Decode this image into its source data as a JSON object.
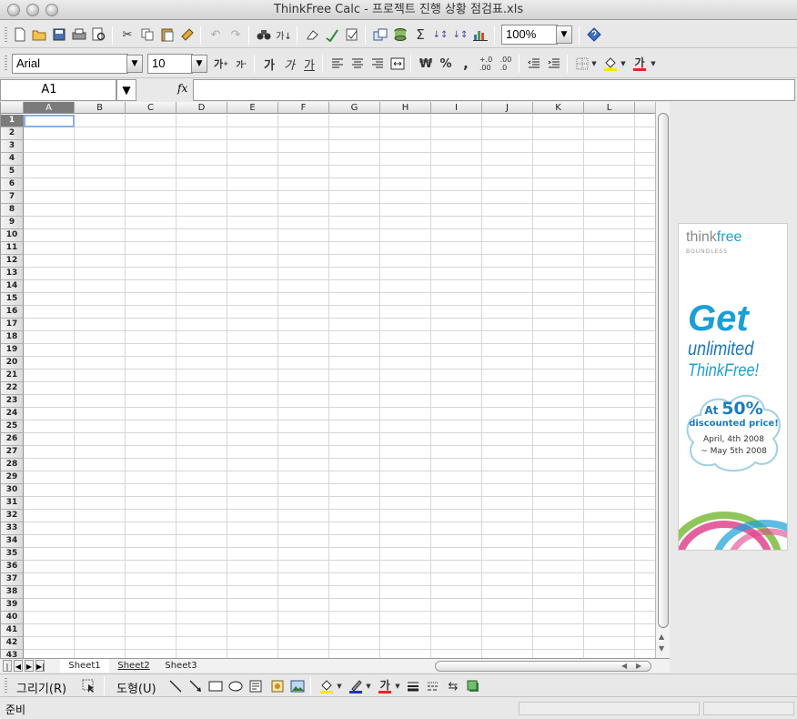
{
  "window": {
    "title": "ThinkFree Calc - 프로젝트 진행 상황 점검표.xls"
  },
  "toolbar": {
    "zoom": "100%",
    "font_name": "Arial",
    "font_size": "10"
  },
  "format_toolbar": {
    "grow_font": "가",
    "shrink_font": "가",
    "bold": "가",
    "italic": "가",
    "underline": "가",
    "currency": "₩",
    "percent": "%",
    "comma": ",",
    "font_color": "가"
  },
  "formula_bar": {
    "cell_ref": "A1",
    "fx": "fx",
    "formula": ""
  },
  "grid": {
    "columns": [
      "A",
      "B",
      "C",
      "D",
      "E",
      "F",
      "G",
      "H",
      "I",
      "J",
      "K",
      "L"
    ],
    "rows": [
      "1",
      "2",
      "3",
      "4",
      "5",
      "6",
      "7",
      "8",
      "9",
      "10",
      "11",
      "12",
      "13",
      "14",
      "15",
      "16",
      "17",
      "18",
      "19",
      "20",
      "21",
      "22",
      "23",
      "24",
      "25",
      "26",
      "27",
      "28",
      "29",
      "30",
      "31",
      "32",
      "33",
      "34",
      "35",
      "36",
      "37",
      "38",
      "39",
      "40",
      "41",
      "42",
      "43"
    ],
    "selected_column": "A",
    "selected_row": "1"
  },
  "sheet_tabs": [
    "Sheet1",
    "Sheet2",
    "Sheet3"
  ],
  "active_sheet": "Sheet1",
  "draw_toolbar": {
    "draw_menu": "그리기(R)",
    "shapes_menu": "도형(U)",
    "font_color": "가"
  },
  "status": {
    "text": "준비"
  },
  "ad": {
    "brand_think": "think",
    "brand_free": "free",
    "tagline": "BOUNDLESS",
    "headline": "Get",
    "line2": "unlimited",
    "line3": "ThinkFree!",
    "offer_at": "At",
    "offer_pct": "50%",
    "offer_text": "discounted price!",
    "date1": "April, 4th 2008",
    "date2": "~ May 5th 2008",
    "colors": {
      "blue": "#1a9fd6",
      "pink": "#e0458c",
      "green": "#7dbb3d"
    }
  }
}
